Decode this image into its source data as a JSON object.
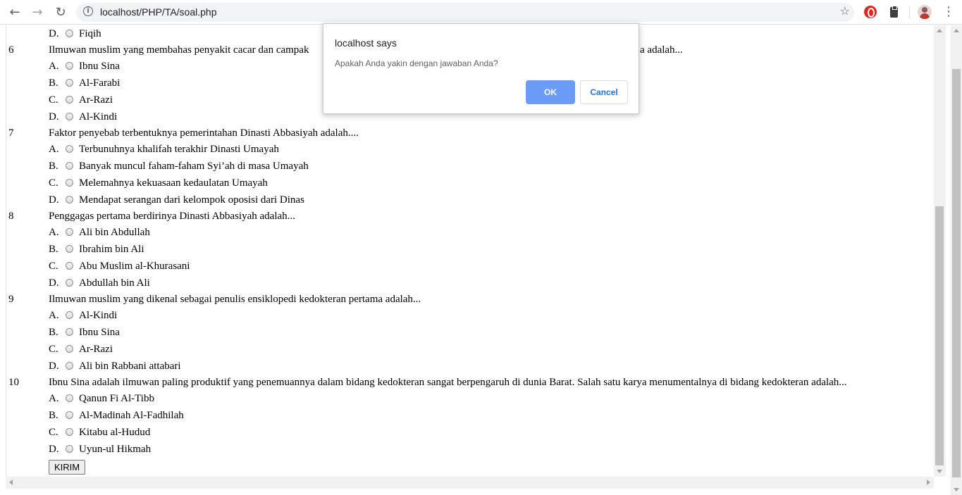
{
  "browser": {
    "url": "localhost/PHP/TA/soal.php",
    "icons": {
      "back": "arrow-left-icon",
      "forward": "arrow-right-icon",
      "reload": "reload-icon",
      "info": "info-icon",
      "star": "star-icon",
      "menu": "vertical-dots-icon"
    }
  },
  "quiz": {
    "top_option": {
      "letter": "D.",
      "text": "Fiqih"
    },
    "questions": [
      {
        "number": "6",
        "text": "Ilmuwan muslim yang membahas penyakit cacar dan campak",
        "text_tail": "a adalah...",
        "options": [
          {
            "letter": "A.",
            "text": "Ibnu Sina"
          },
          {
            "letter": "B.",
            "text": "Al-Farabi"
          },
          {
            "letter": "C.",
            "text": "Ar-Razi"
          },
          {
            "letter": "D.",
            "text": "Al-Kindi"
          }
        ]
      },
      {
        "number": "7",
        "text": "Faktor penyebab terbentuknya pemerintahan Dinasti Abbasiyah adalah....",
        "options": [
          {
            "letter": "A.",
            "text": "Terbunuhnya khalifah terakhir Dinasti Umayah"
          },
          {
            "letter": "B.",
            "text": "Banyak muncul faham-faham Syi’ah di masa Umayah"
          },
          {
            "letter": "C.",
            "text": "Melemahnya kekuasaan kedaulatan Umayah"
          },
          {
            "letter": "D.",
            "text": "Mendapat serangan dari kelompok oposisi dari Dinas"
          }
        ]
      },
      {
        "number": "8",
        "text": "Penggagas pertama berdirinya Dinasti Abbasiyah adalah...",
        "options": [
          {
            "letter": "A.",
            "text": "Ali bin Abdullah"
          },
          {
            "letter": "B.",
            "text": "Ibrahim bin Ali"
          },
          {
            "letter": "C.",
            "text": "Abu Muslim al-Khurasani"
          },
          {
            "letter": "D.",
            "text": "Abdullah bin Ali"
          }
        ]
      },
      {
        "number": "9",
        "text": "Ilmuwan muslim yang dikenal sebagai penulis ensiklopedi kedokteran pertama adalah...",
        "options": [
          {
            "letter": "A.",
            "text": "Al-Kindi"
          },
          {
            "letter": "B.",
            "text": "Ibnu Sina"
          },
          {
            "letter": "C.",
            "text": "Ar-Razi"
          },
          {
            "letter": "D.",
            "text": "Ali bin Rabbani attabari"
          }
        ]
      },
      {
        "number": "10",
        "text": "Ibnu Sina adalah ilmuwan paling produktif yang penemuannya dalam bidang kedokteran sangat berpengaruh di dunia Barat. Salah satu karya menumentalnya di bidang kedokteran adalah...",
        "options": [
          {
            "letter": "A.",
            "text": "Qanun Fi Al-Tibb"
          },
          {
            "letter": "B.",
            "text": "Al-Madinah Al-Fadhilah"
          },
          {
            "letter": "C.",
            "text": "Kitabu al-Hudud"
          },
          {
            "letter": "D.",
            "text": "Uyun-ul Hikmah"
          }
        ]
      }
    ],
    "submit_label": "KIRIM"
  },
  "dialog": {
    "title": "localhost says",
    "message": "Apakah Anda yakin dengan jawaban Anda?",
    "ok_label": "OK",
    "cancel_label": "Cancel"
  }
}
